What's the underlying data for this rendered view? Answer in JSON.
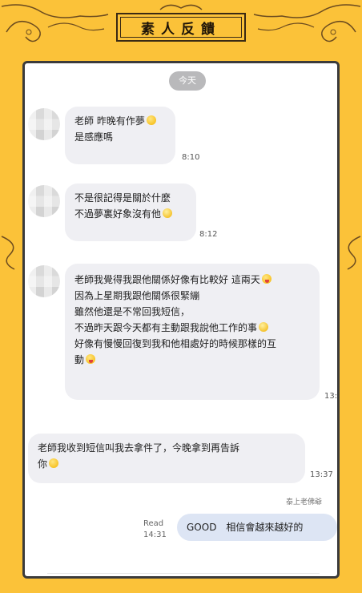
{
  "header": {
    "title": "素人反饋"
  },
  "chat": {
    "date_label": "今天",
    "messages": [
      {
        "lines": [
          "老師 昨晚有作夢",
          "是感應嗎"
        ],
        "time": "8:10"
      },
      {
        "lines": [
          "不是很記得是關於什麼",
          "不過夢裏好象沒有他"
        ],
        "time": "8:12"
      },
      {
        "lines": [
          "老師我覺得我跟他關係好像有比較好 這兩天",
          "因為上星期我跟他關係很緊繃",
          "雖然他還是不常回我短信，",
          "不過昨天跟今天都有主動跟我說他工作的事",
          "好像有慢慢回復到我和他相處好的時候那樣的互",
          "動"
        ],
        "time": "13:"
      },
      {
        "lines": [
          "老師我收到短信叫我去拿件了，今晚拿到再告訴",
          "你"
        ],
        "time": "13:37"
      }
    ],
    "sender_name": "泰上老佛爺",
    "reply": {
      "read_label": "Read",
      "time": "14:31",
      "text": "GOOD　相信會越來越好的"
    }
  },
  "colors": {
    "background": "#fbc239",
    "bubble_in": "#efeff3",
    "bubble_out": "#dde5f4"
  }
}
